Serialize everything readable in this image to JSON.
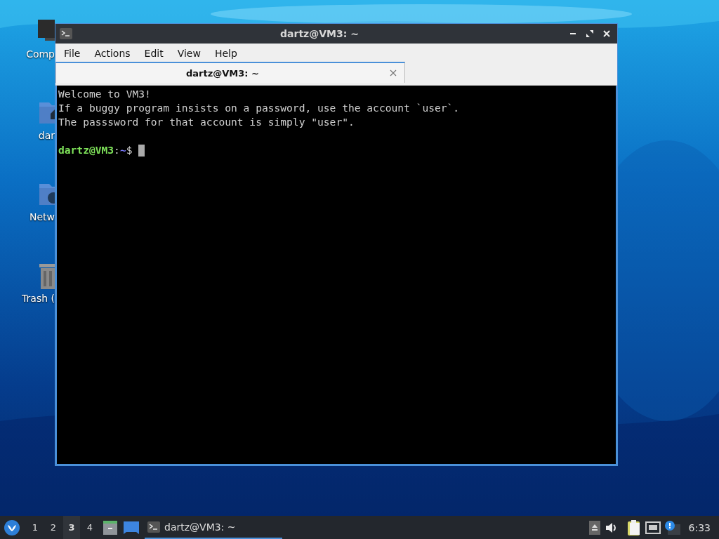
{
  "desktop_icons": [
    {
      "kind": "computer",
      "label": "Comp"
    },
    {
      "kind": "home",
      "label": "dar"
    },
    {
      "kind": "network",
      "label": "Netw"
    },
    {
      "kind": "trash",
      "label": "Trash ("
    }
  ],
  "window": {
    "title": "dartz@VM3: ~",
    "menu": [
      "File",
      "Actions",
      "Edit",
      "View",
      "Help"
    ],
    "tabs": [
      {
        "label": "dartz@VM3: ~",
        "selected": true
      }
    ],
    "terminal": {
      "lines": [
        {
          "kind": "text",
          "text": "Welcome to VM3!"
        },
        {
          "kind": "text",
          "text": "If a buggy program insists on a password, use the account `user`."
        },
        {
          "kind": "text",
          "text": "The passsword for that account is simply \"user\"."
        },
        {
          "kind": "blank"
        },
        {
          "kind": "prompt",
          "user_host": "dartz@VM3",
          "separator": ":",
          "path": "~",
          "symbol": "$"
        }
      ]
    }
  },
  "taskbar": {
    "workspaces": [
      {
        "label": "1",
        "selected": false
      },
      {
        "label": "2",
        "selected": false
      },
      {
        "label": "3",
        "selected": true
      },
      {
        "label": "4",
        "selected": false
      }
    ],
    "tasks": [
      {
        "label": "dartz@VM3: ~",
        "selected": true
      }
    ],
    "clock": "6:33"
  }
}
